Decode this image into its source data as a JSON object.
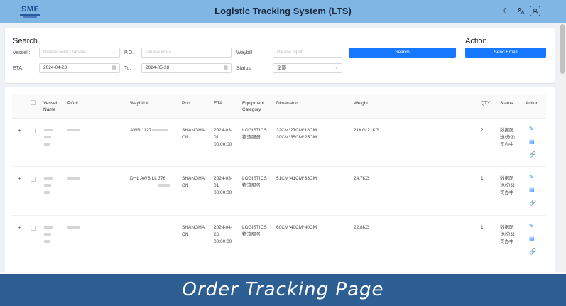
{
  "header": {
    "logo_text": "SME",
    "title": "Logistic Tracking System (LTS)",
    "icons": [
      "moon-icon",
      "translate-icon",
      "user-icon"
    ]
  },
  "search": {
    "heading": "Search",
    "action_heading": "Action",
    "vessel_label": "Vessel :",
    "vessel_placeholder": "Please select Vessel",
    "po_label": "P.O.",
    "po_placeholder": "Please input",
    "waybill_label": "Waybill",
    "waybill_placeholder": "Please input",
    "search_button": "Search",
    "eta_label": "ETA:",
    "eta_from": "2024-04-28",
    "to_label": "To:",
    "eta_to": "2024-05-28",
    "status_label": "Status:",
    "status_value": "全部",
    "send_email_button": "Send Email"
  },
  "table": {
    "headers": {
      "vessel_name": "Vessel Name",
      "po": "PO #",
      "waybill": "Waybill #",
      "port": "Port",
      "eta": "ETA",
      "equipment": "Equipment Category",
      "dimension": "Dimension",
      "weight": "Weight",
      "qty": "QTY",
      "status": "Status",
      "action": "Action"
    },
    "rows": [
      {
        "waybill": "AWB 1127",
        "port": "SHANGHA CN",
        "eta": "2024-03- 01 00:00:00",
        "equipment": "LOGISTICS 物流服务",
        "dimension": "32CM*27CM*18CM 30CM*35CM*25CM",
        "weight": "21KG*21KG",
        "qty": "2",
        "status": "数据配 送/分公 司办中"
      },
      {
        "waybill": "DHL AWBILL 376",
        "port": "SHANGHA CN",
        "eta": "2024-03- 01 00:00:00",
        "equipment": "LOGISTICS 物流服务",
        "dimension": "51CM*41CM*33CM",
        "weight": "24.7KG",
        "qty": "1",
        "status": "数据配 送/分公 司办中"
      },
      {
        "waybill": "",
        "port": "SHANGHA CN",
        "eta": "2024-04- 26 00:00:00",
        "equipment": "LOGISTICS 物流服务",
        "dimension": "60CM*40CM*40CM",
        "weight": "22.8KG",
        "qty": "1",
        "status": "数据配 送/分公 司办中"
      }
    ]
  },
  "banner": {
    "text": "Order Tracking Page"
  },
  "colors": {
    "header_bg": "#7fb6e3",
    "primary": "#1677ff",
    "banner_bg": "#2d5f93"
  }
}
